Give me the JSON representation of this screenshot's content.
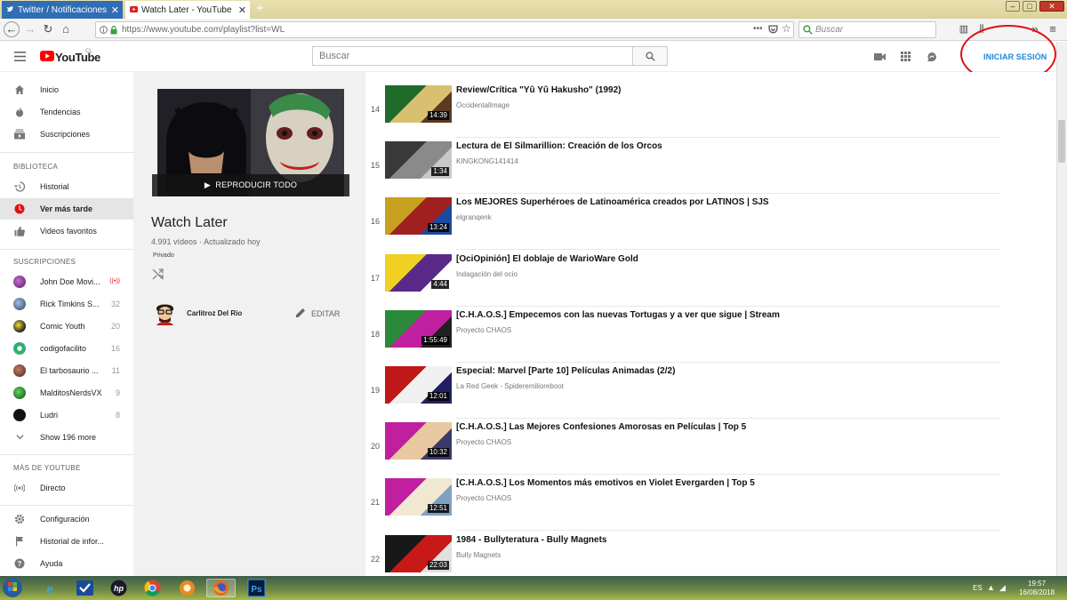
{
  "browser": {
    "tabs": [
      {
        "title": "Twitter / Notificaciones"
      },
      {
        "title": "Watch Later - YouTube"
      }
    ],
    "url": "https://www.youtube.com/playlist?list=WL",
    "search_placeholder": "Buscar"
  },
  "header": {
    "logo": "YouTube",
    "logo_region": "CL",
    "search_placeholder": "Buscar",
    "signin_label": "INICIAR SESIÓN",
    "annotation_color": "#e01010"
  },
  "sidebar": {
    "top": [
      {
        "label": "Inicio",
        "icon": "home-icon"
      },
      {
        "label": "Tendencias",
        "icon": "flame-icon"
      },
      {
        "label": "Suscripciones",
        "icon": "subscriptions-icon"
      }
    ],
    "library_heading": "BIBLIOTECA",
    "library": [
      {
        "label": "Historial",
        "icon": "history-icon"
      },
      {
        "label": "Ver más tarde",
        "icon": "clock-icon",
        "active": true
      },
      {
        "label": "Videos favoritos",
        "icon": "thumbs-up-icon"
      }
    ],
    "subs_heading": "SUSCRIPCIONES",
    "subscriptions": [
      {
        "label": "John Doe Movi...",
        "count": "((•))"
      },
      {
        "label": "Rick Timkins S...",
        "count": "32"
      },
      {
        "label": "Comic Youth",
        "count": "20"
      },
      {
        "label": "codigofacilito",
        "count": "16"
      },
      {
        "label": "El tarbosaurio ...",
        "count": "11"
      },
      {
        "label": "MalditosNerdsVX",
        "count": "9"
      },
      {
        "label": "Ludri",
        "count": "8"
      }
    ],
    "show_more": "Show 196 more",
    "more_heading": "MÁS DE YOUTUBE",
    "more": [
      {
        "label": "Directo",
        "icon": "live-icon"
      }
    ],
    "bottom": [
      {
        "label": "Configuración",
        "icon": "gear-icon"
      },
      {
        "label": "Historial de infor...",
        "icon": "flag-icon"
      },
      {
        "label": "Ayuda",
        "icon": "help-icon"
      }
    ]
  },
  "playlist": {
    "play_all": "REPRODUCIR TODO",
    "title": "Watch Later",
    "videos_count": "4.991 vídeos",
    "updated": "Actualizado hoy",
    "privacy": "Privado",
    "owner": "Carlitroz Del Rio",
    "edit_label": "EDITAR"
  },
  "videos": [
    {
      "index": "14",
      "title": "Review/Crítica \"Yû Yû Hakusho\" (1992)",
      "channel": "OccidentalImage",
      "duration": "14:39",
      "colors": [
        "#1f6b2a",
        "#d8c070",
        "#5a3a20"
      ]
    },
    {
      "index": "15",
      "title": "Lectura de El Silmarillion: Creación de los Orcos",
      "channel": "KINGKONG141414",
      "duration": "1:34",
      "colors": [
        "#3a3a3a",
        "#8a8a8a",
        "#c8c8c8"
      ]
    },
    {
      "index": "16",
      "title": "Los MEJORES Superhéroes de Latinoamérica creados por LATINOS | SJS",
      "channel": "elgranqenk",
      "duration": "13:24",
      "colors": [
        "#c8a020",
        "#a02020",
        "#1a4aa0"
      ]
    },
    {
      "index": "17",
      "title": "[OciOpinión] El doblaje de WarioWare Gold",
      "channel": "Indagación del ocio",
      "duration": "4:44",
      "colors": [
        "#f0d020",
        "#5a2a8a",
        "#ffffff"
      ]
    },
    {
      "index": "18",
      "title": "[C.H.A.O.S.] Empecemos con las nuevas Tortugas y a ver que sigue | Stream",
      "channel": "Proyecto CHAOS",
      "duration": "1:55:49",
      "colors": [
        "#2a8a3a",
        "#c020a0",
        "#202020"
      ]
    },
    {
      "index": "19",
      "title": "Especial: Marvel [Parte 10] Películas Animadas (2/2)",
      "channel": "La Red Geek - Spideremilioreboot",
      "duration": "12:01",
      "colors": [
        "#c01818",
        "#f0f0f0",
        "#202060"
      ]
    },
    {
      "index": "20",
      "title": "[C.H.A.O.S.] Las Mejores Confesiones Amorosas en Películas | Top 5",
      "channel": "Proyecto CHAOS",
      "duration": "10:32",
      "colors": [
        "#c020a0",
        "#e8c8a0",
        "#3a3a6a"
      ]
    },
    {
      "index": "21",
      "title": "[C.H.A.O.S.] Los Momentos más emotivos en Violet Evergarden | Top 5",
      "channel": "Proyecto CHAOS",
      "duration": "12:51",
      "colors": [
        "#c020a0",
        "#f0e8d0",
        "#80a0c0"
      ]
    },
    {
      "index": "22",
      "title": "1984 - Bullyteratura - Bully Magnets",
      "channel": "Bully Magnets",
      "duration": "22:03",
      "colors": [
        "#181818",
        "#c81818",
        "#e0e0e0"
      ]
    }
  ],
  "taskbar": {
    "apps": [
      "start-orb",
      "internet-explorer",
      "outlook",
      "hp",
      "chrome",
      "app-orange",
      "firefox",
      "photoshop"
    ],
    "language": "ES",
    "time": "19:57",
    "date": "16/08/2018"
  }
}
